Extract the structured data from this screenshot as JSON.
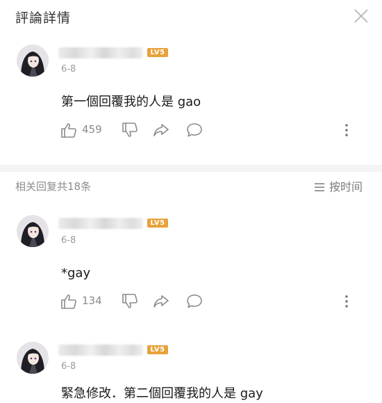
{
  "header": {
    "title": "評論詳情"
  },
  "main_comment": {
    "level": "LV5",
    "date": "6-8",
    "text": "第一個回覆我的人是 gao",
    "likes": "459"
  },
  "replies_header": {
    "count_label": "相关回复共18条",
    "sort_label": "按时间"
  },
  "replies": [
    {
      "level": "LV5",
      "date": "6-8",
      "text": "*gay",
      "likes": "134"
    },
    {
      "level": "LV5",
      "date": "6-8",
      "text": "緊急修改．第二個回覆我的人是 gay"
    }
  ],
  "icons": {
    "close": "close-icon",
    "like": "thumbs-up-icon",
    "dislike": "thumbs-down-icon",
    "share": "share-icon",
    "comment": "comment-bubble-icon",
    "more": "more-vertical-icon",
    "sort": "list-icon"
  },
  "colors": {
    "level_badge": "#e8a23a",
    "divider": "#f4f4f4"
  }
}
